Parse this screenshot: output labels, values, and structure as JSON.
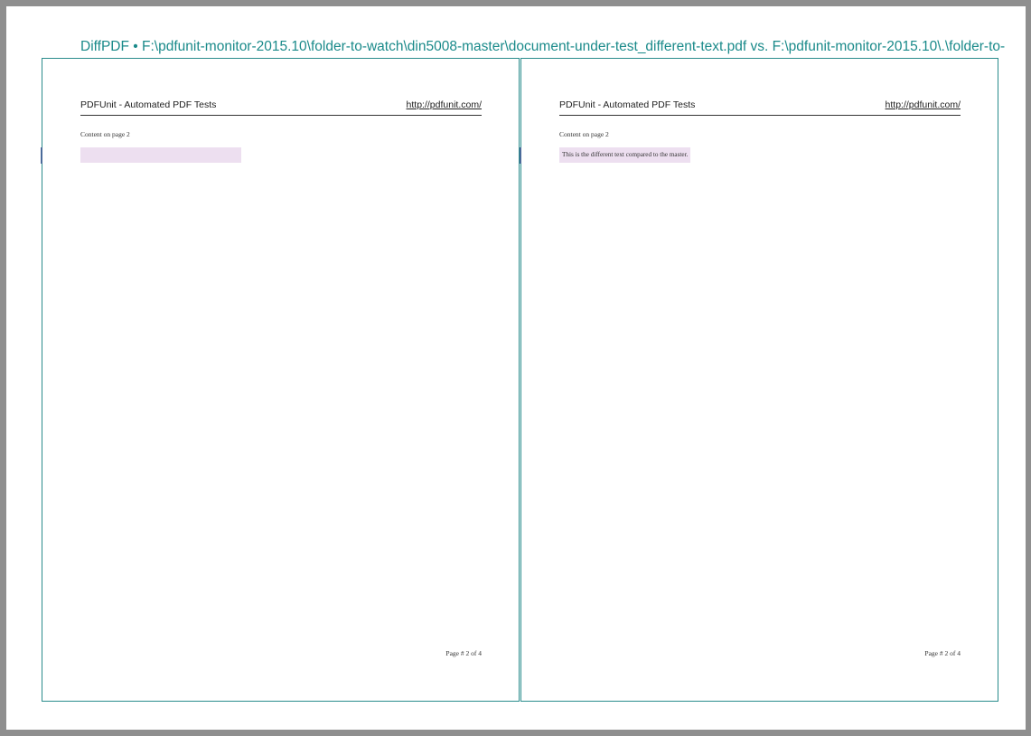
{
  "window": {
    "title": "DiffPDF • F:\\pdfunit-monitor-2015.10\\folder-to-watch\\din5008-master\\document-under-test_different-text.pdf vs. F:\\pdfunit-monitor-2015.10\\.\\folder-to-"
  },
  "left_page": {
    "header_title": "PDFUnit - Automated PDF Tests",
    "header_link": "http://pdfunit.com/",
    "content": "Content on page 2",
    "diff_text": "",
    "footer": "Page # 2 of 4"
  },
  "right_page": {
    "header_title": "PDFUnit - Automated PDF Tests",
    "header_link": "http://pdfunit.com/",
    "content": "Content on page 2",
    "diff_text": "This is the different text compared to the master.",
    "footer": "Page # 2 of 4"
  },
  "colors": {
    "frame": "#2a8c8c",
    "title": "#1a8a8a",
    "diff_highlight": "#eddff0",
    "background": "#8f8f8f"
  }
}
